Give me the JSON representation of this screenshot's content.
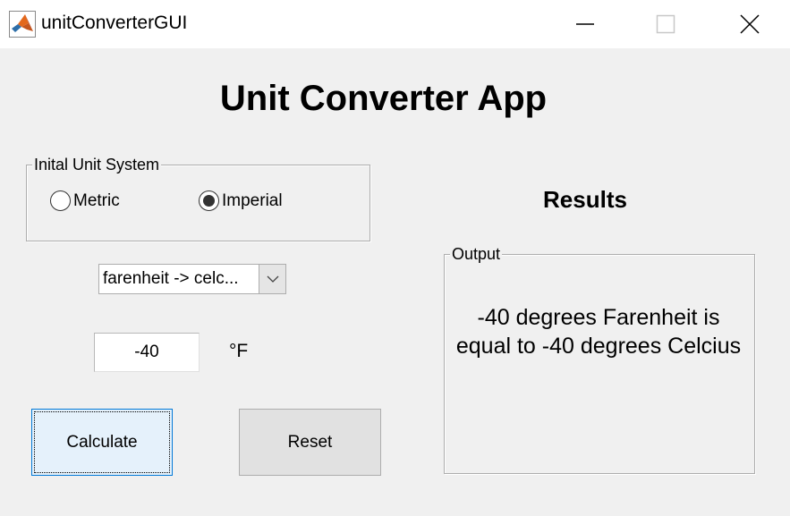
{
  "window": {
    "title": "unitConverterGUI",
    "icon": "matlab-logo-icon",
    "controls": [
      "minimize-icon",
      "maximize-icon",
      "close-icon"
    ]
  },
  "app": {
    "title": "Unit Converter App"
  },
  "unit_system": {
    "legend": "Inital Unit System",
    "options": [
      {
        "label": "Metric",
        "selected": false
      },
      {
        "label": "Imperial",
        "selected": true
      }
    ]
  },
  "conversion": {
    "selected": "farenheit -> celc..."
  },
  "input": {
    "value": "-40",
    "unit": "°F"
  },
  "buttons": {
    "calculate": "Calculate",
    "reset": "Reset"
  },
  "results": {
    "title": "Results",
    "output_legend": "Output",
    "output_text": "-40 degrees Farenheit is equal to -40 degrees Celcius"
  },
  "colors": {
    "background": "#f0f0f0",
    "calculate_button_bg": "#e5f1fb",
    "calculate_button_border": "#0078d7"
  }
}
